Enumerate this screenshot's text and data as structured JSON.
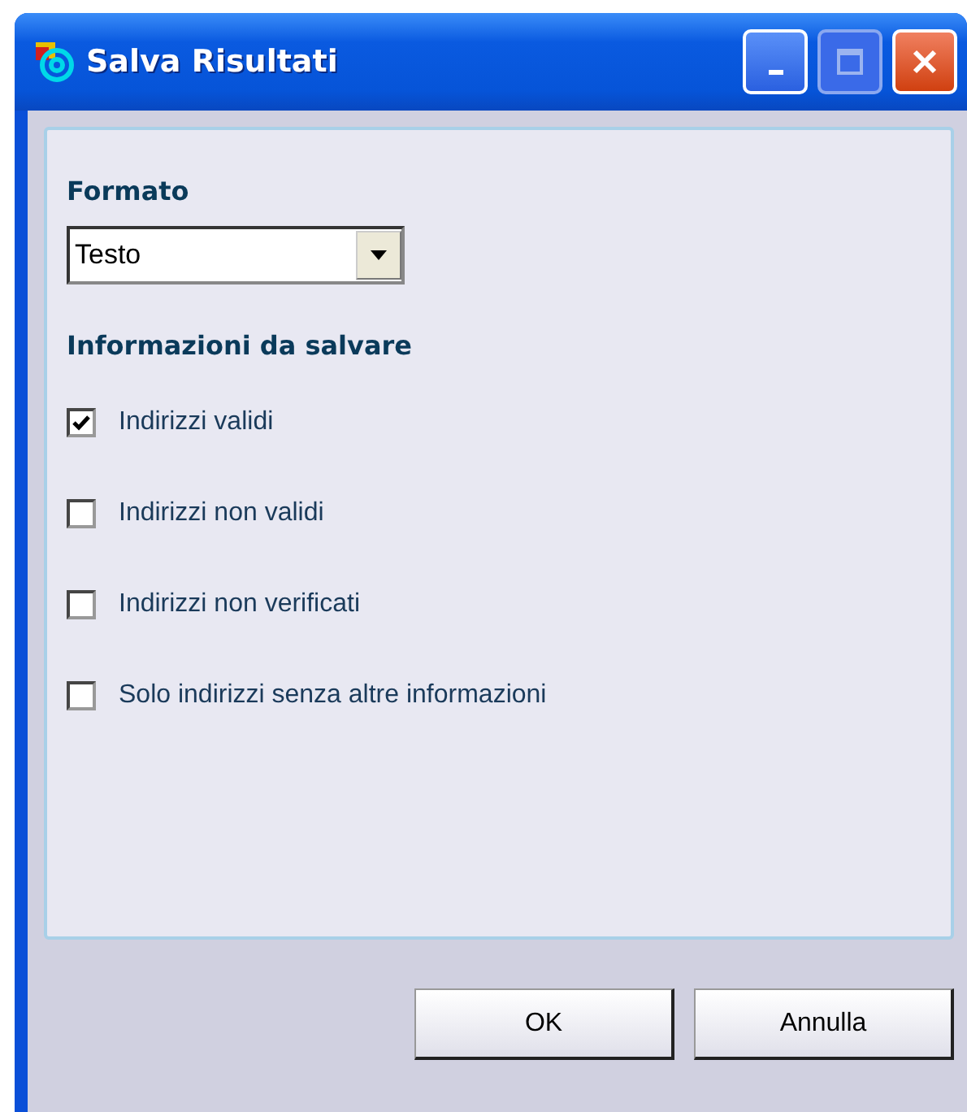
{
  "window": {
    "title": "Salva Risultati"
  },
  "format": {
    "label": "Formato",
    "value": "Testo"
  },
  "section": {
    "label": "Informazioni da salvare"
  },
  "options": [
    {
      "label": "Indirizzi validi",
      "checked": true
    },
    {
      "label": "Indirizzi non validi",
      "checked": false
    },
    {
      "label": "Indirizzi non verificati",
      "checked": false
    }
  ],
  "extra_options": [
    {
      "label": "Solo indirizzi senza altre informazioni",
      "checked": false
    }
  ],
  "buttons": [
    {
      "label": "OK"
    },
    {
      "label": "Annulla"
    }
  ]
}
